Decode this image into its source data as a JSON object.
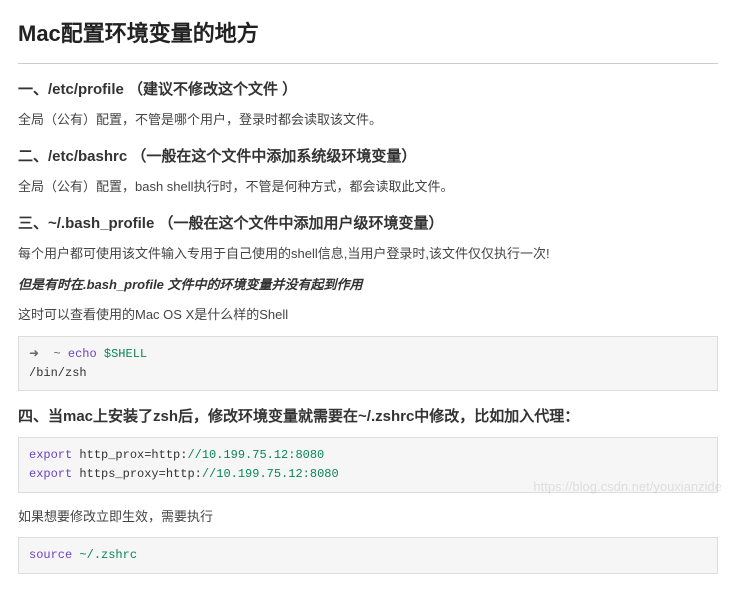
{
  "title": "Mac配置环境变量的地方",
  "sections": [
    {
      "heading": "一、/etc/profile （建议不修改这个文件 ）",
      "paras": [
        "全局（公有）配置，不管是哪个用户，登录时都会读取该文件。"
      ]
    },
    {
      "heading": "二、/etc/bashrc （一般在这个文件中添加系统级环境变量）",
      "paras": [
        "全局（公有）配置，bash shell执行时，不管是何种方式，都会读取此文件。"
      ]
    },
    {
      "heading": "三、~/.bash_profile （一般在这个文件中添加用户级环境变量）",
      "paras": [
        "每个用户都可使用该文件输入专用于自己使用的shell信息,当用户登录时,该文件仅仅执行一次!",
        "这时可以查看使用的Mac OS X是什么样的Shell"
      ],
      "emph": "但是有时在.bash_profile 文件中的环境变量并没有起到作用"
    }
  ],
  "code1": {
    "arrow": "➜",
    "tilde": "~",
    "cmd": "echo",
    "var": "$SHELL",
    "output": "/bin/zsh"
  },
  "section4": {
    "heading": "四、当mac上安装了zsh后，修改环境变量就需要在~/.zshrc中修改，比如加入代理：",
    "after": "如果想要修改立即生效，需要执行"
  },
  "code2": {
    "l1_kw": "export",
    "l1_key": " http_prox=http:",
    "l1_val": "//10.199.75.12:8080",
    "l2_kw": "export",
    "l2_key": " https_proxy=http:",
    "l2_val": "//10.199.75.12:8080"
  },
  "code3": {
    "kw": "source",
    "arg": " ~/.zshrc"
  },
  "watermark": "https://blog.csdn.net/youxianzide"
}
